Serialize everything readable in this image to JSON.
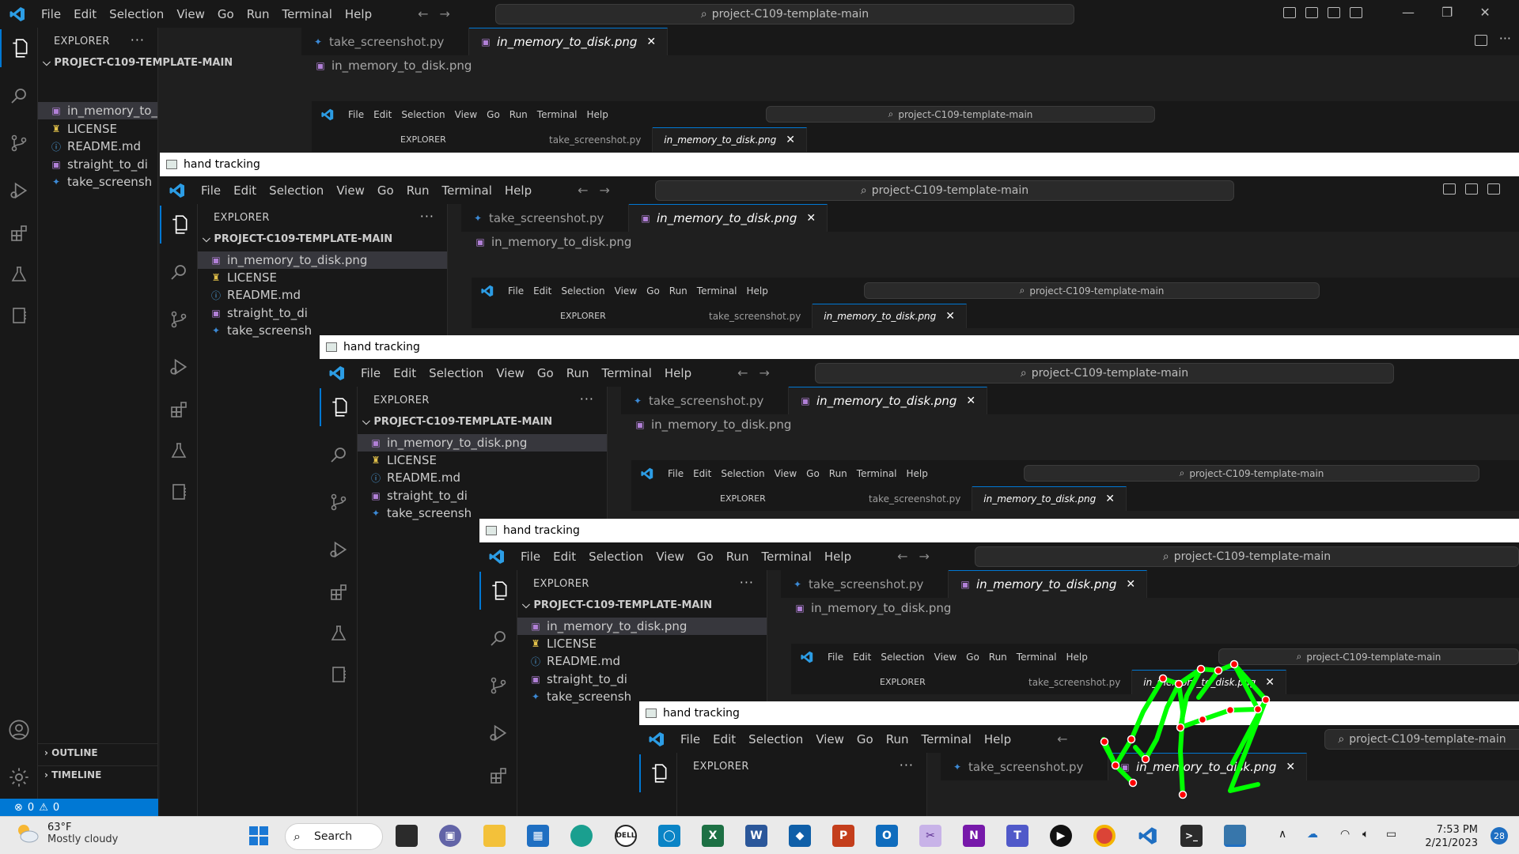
{
  "menu": [
    "File",
    "Edit",
    "Selection",
    "View",
    "Go",
    "Run",
    "Terminal",
    "Help"
  ],
  "search_label": "project-C109-template-main",
  "explorer_label": "EXPLORER",
  "root_folder": "PROJECT-C109-TEMPLATE-MAIN",
  "files": [
    {
      "name": "in_memory_to_disk.png",
      "type": "image",
      "selected": true
    },
    {
      "name": "LICENSE",
      "type": "license"
    },
    {
      "name": "README.md",
      "type": "info"
    },
    {
      "name": "straight_to_di",
      "type": "image"
    },
    {
      "name": "take_screensh",
      "type": "python"
    }
  ],
  "tabs": [
    {
      "label": "take_screenshot.py",
      "active": false
    },
    {
      "label": "in_memory_to_disk.png",
      "active": true
    }
  ],
  "breadcrumb": "in_memory_to_disk.png",
  "outline_label": "OUTLINE",
  "timeline_label": "TIMELINE",
  "status": {
    "errors": "0",
    "warnings": "0"
  },
  "hand_window_title": "hand tracking",
  "taskbar": {
    "weather_temp": "63°F",
    "weather_condition": "Mostly cloudy",
    "search_label": "Search",
    "time": "7:53 PM",
    "date": "2/21/2023",
    "notifications": "28"
  },
  "colors": {
    "accent": "#0078d4",
    "hand_lines": "#00ff00",
    "hand_points": "#ff0000"
  }
}
